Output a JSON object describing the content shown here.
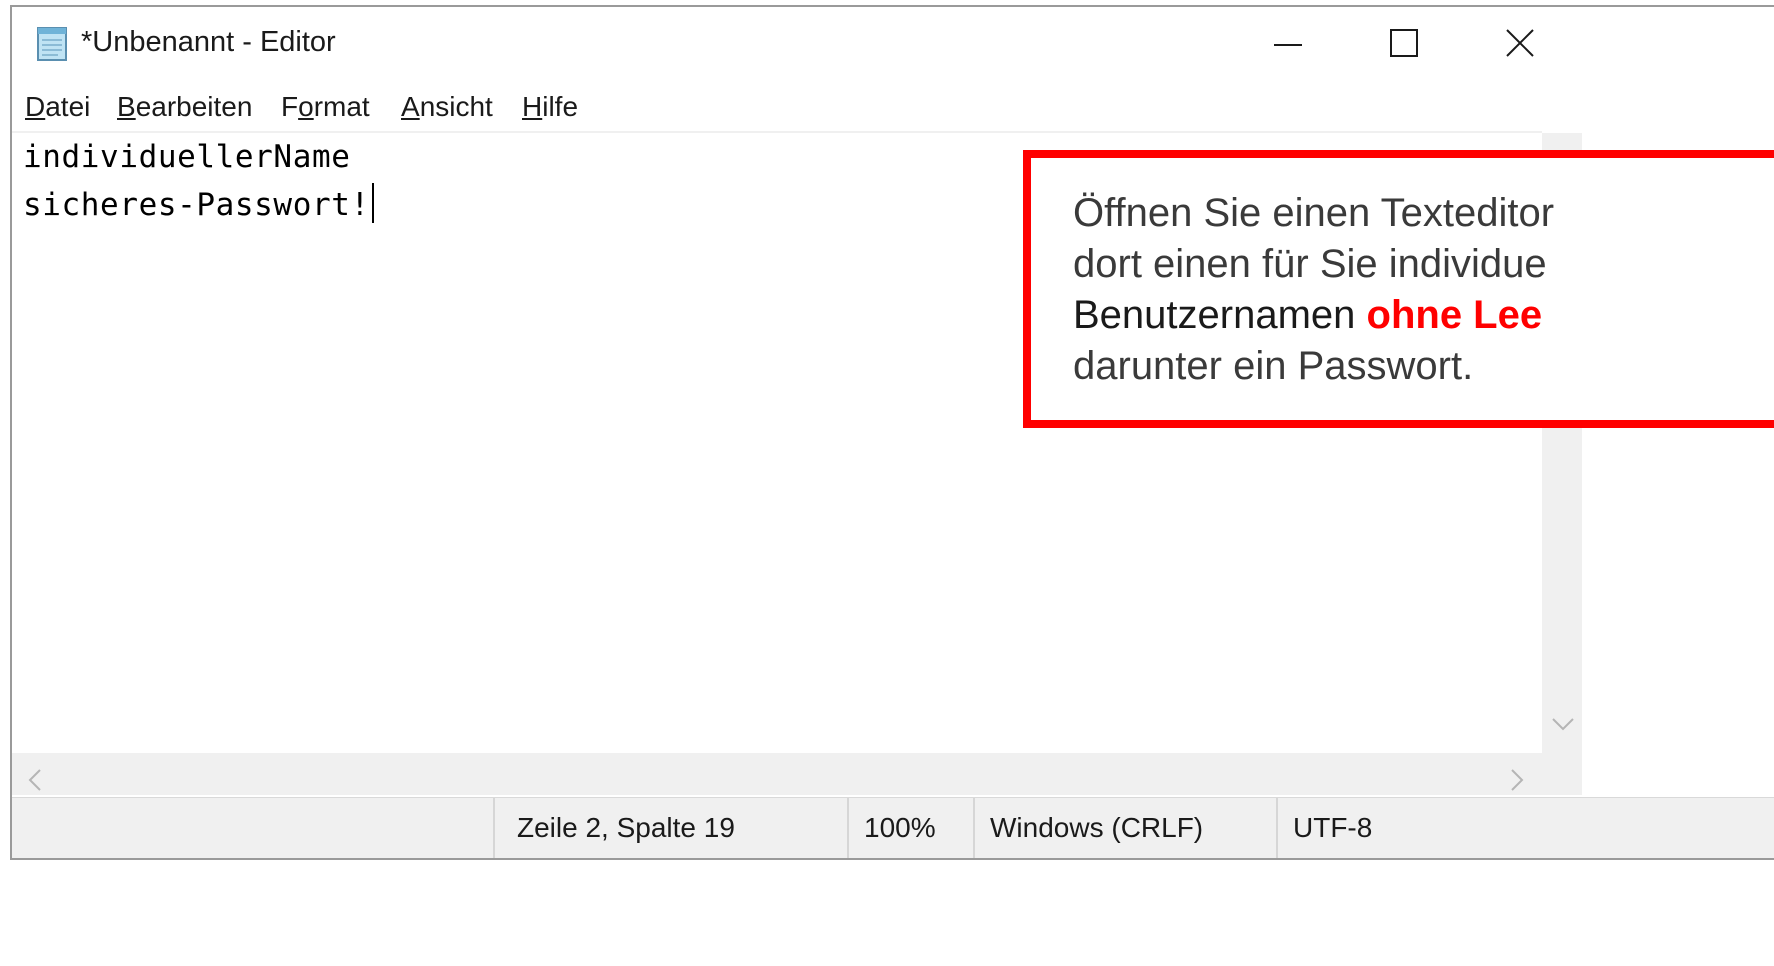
{
  "window": {
    "title": "*Unbenannt - Editor",
    "controls": {
      "minimize": "minimize",
      "maximize": "maximize",
      "close": "close"
    }
  },
  "menu": [
    {
      "mnemonic": "D",
      "rest": "atei"
    },
    {
      "mnemonic": "B",
      "rest": "earbeiten"
    },
    {
      "pre": "F",
      "mnemonic": "o",
      "rest": "rmat"
    },
    {
      "mnemonic": "A",
      "rest": "nsicht"
    },
    {
      "mnemonic": "H",
      "rest": "ilfe"
    }
  ],
  "editor": {
    "lines": [
      "individuellerName",
      "sicheres-Passwort!"
    ]
  },
  "statusbar": {
    "position": "Zeile 2, Spalte 19",
    "zoom": "100%",
    "line_ending": "Windows (CRLF)",
    "encoding": "UTF-8"
  },
  "callout": {
    "line1": "Öffnen Sie einen Texteditor",
    "line2": "dort einen für Sie individue",
    "line3_plain": "Benutzernamen ",
    "line3_highlight": "ohne Lee",
    "line4": "darunter ein Passwort.",
    "border_color": "#ff0000",
    "highlight_color": "#ff0000"
  },
  "icons": {
    "app": "notepad-icon",
    "minimize": "minimize-icon",
    "maximize": "maximize-icon",
    "close": "close-icon",
    "scroll_down": "chevron-down-icon",
    "scroll_left": "chevron-left-icon",
    "scroll_right": "chevron-right-icon"
  }
}
